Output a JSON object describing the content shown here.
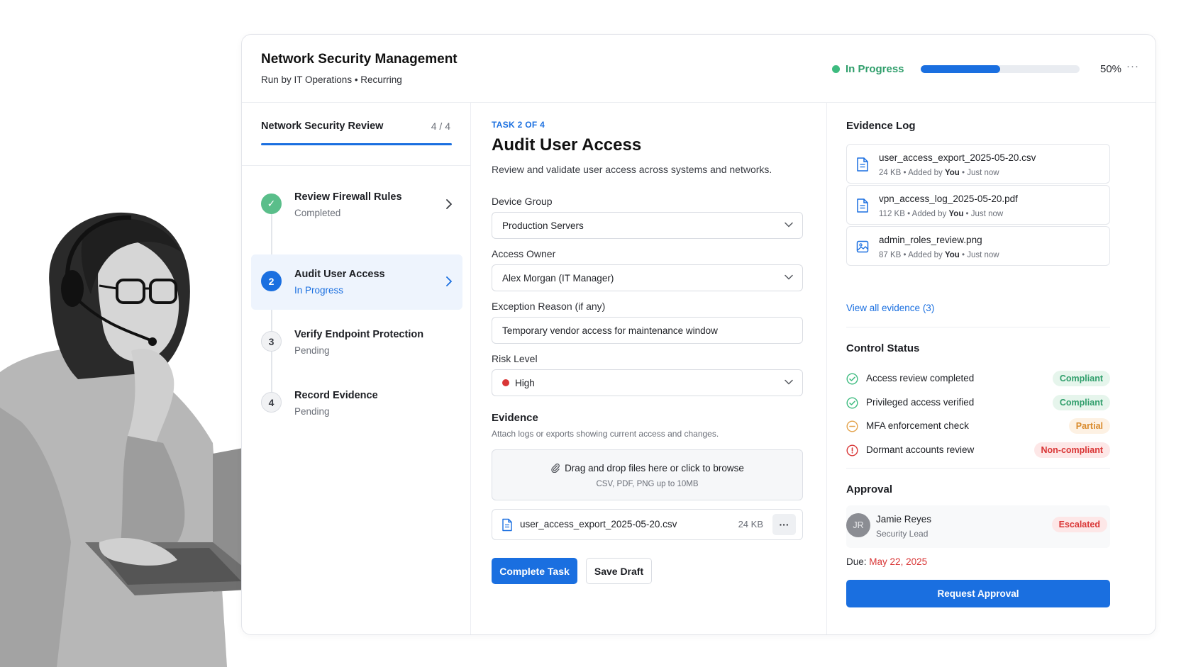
{
  "header": {
    "title": "Network Security Management",
    "subtitle": "Run by IT Operations • Recurring",
    "status": "In Progress",
    "progress_label": "50%",
    "progress_value": 0.5,
    "more": "···"
  },
  "workflow": {
    "name": "Network Security Review",
    "count": "4 / 4",
    "steps": [
      {
        "num": "✓",
        "title": "Review Firewall Rules",
        "status": "Completed"
      },
      {
        "num": "2",
        "title": "Audit User Access",
        "status": "In Progress"
      },
      {
        "num": "3",
        "title": "Verify Endpoint Protection",
        "status": "Pending"
      },
      {
        "num": "4",
        "title": "Record Evidence",
        "status": "Pending"
      }
    ]
  },
  "task": {
    "label": "TASK 2 OF 4",
    "title": "Audit User Access",
    "description": "Review and validate user access across systems and networks.",
    "fields": {
      "device_group_label": "Device Group",
      "device_group_value": "Production Servers",
      "access_owner_label": "Access Owner",
      "access_owner_value": "Alex Morgan (IT Manager)",
      "exception_label": "Exception Reason (if any)",
      "exception_value": "Temporary vendor access for maintenance window",
      "risk_label": "Risk Level",
      "risk_value": "High"
    },
    "evidence": {
      "heading": "Evidence",
      "subtext": "Attach logs or exports showing current access and changes.",
      "drop_line1": "Drag and drop files here or click to browse",
      "drop_line2": "CSV, PDF, PNG up to 10MB",
      "file_name": "user_access_export_2025-05-20.csv",
      "file_size": "24 KB",
      "file_menu": "···"
    },
    "complete_button": "Complete Task",
    "save_button": "Save Draft"
  },
  "evidence_log": {
    "heading": "Evidence Log",
    "items": [
      {
        "name": "user_access_export_2025-05-20.csv",
        "size": "24 KB",
        "added": "Added by",
        "by": "You",
        "time": "Just now",
        "icon": "document-icon"
      },
      {
        "name": "vpn_access_log_2025-05-20.pdf",
        "size": "112 KB",
        "added": "Added by",
        "by": "You",
        "time": "Just now",
        "icon": "document-icon"
      },
      {
        "name": "admin_roles_review.png",
        "size": "87 KB",
        "added": "Added by",
        "by": "You",
        "time": "Just now",
        "icon": "image-icon"
      }
    ],
    "view_all": "View all evidence (3)"
  },
  "control_status": {
    "heading": "Control Status",
    "items": [
      {
        "label": "Access review completed",
        "badge": "Compliant",
        "state": "green"
      },
      {
        "label": "Privileged access verified",
        "badge": "Compliant",
        "state": "green"
      },
      {
        "label": "MFA enforcement check",
        "badge": "Partial",
        "state": "amber"
      },
      {
        "label": "Dormant accounts review",
        "badge": "Non-compliant",
        "state": "red"
      }
    ]
  },
  "approval": {
    "heading": "Approval",
    "initials": "JR",
    "name": "Jamie Reyes",
    "role": "Security Lead",
    "badge": "Escalated",
    "due_label": "Due:",
    "due_date": "May 22, 2025",
    "button": "Request Approval"
  },
  "colors": {
    "accent": "#1a6fe0",
    "success": "#3dbb7f",
    "warning": "#d98a2b",
    "danger": "#d93636"
  }
}
